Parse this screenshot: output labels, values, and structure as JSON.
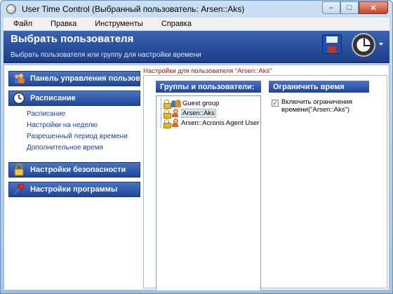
{
  "window": {
    "title": "User Time Control (Выбранный пользователь: Arsen::Aks)",
    "controls": {
      "minimize": "–",
      "maximize": "□",
      "close": "✕"
    }
  },
  "menu": {
    "items": [
      {
        "label": "Файл"
      },
      {
        "label": "Правка"
      },
      {
        "label": "Инструменты"
      },
      {
        "label": "Справка"
      }
    ]
  },
  "banner": {
    "title": "Выбрать пользователя",
    "subtitle": "Выбрать пользователя или группу для настройки времени",
    "icons": [
      "save-icon",
      "clock-icon"
    ]
  },
  "sidebar": {
    "groups": [
      {
        "label": "Панель управления пользователями",
        "icon": "users-icon",
        "links": []
      },
      {
        "label": "Расписание",
        "icon": "clock-icon",
        "links": [
          "Расписание",
          "Настройки на неделю",
          "Разрешенный период времени",
          "Дополнительное время"
        ]
      },
      {
        "label": "Настройки безопасности",
        "icon": "lock-icon",
        "links": []
      },
      {
        "label": "Настройки программы",
        "icon": "pin-icon",
        "links": []
      }
    ]
  },
  "main": {
    "settings_for_label": "Настройки для пользователя \"Arsen::Aks\"",
    "users_panel": {
      "title": "Группы и пользователи:",
      "entries": [
        {
          "name": "Guest group",
          "type": "group",
          "selected": false
        },
        {
          "name": "Arsen::Aks",
          "type": "user",
          "selected": true
        },
        {
          "name": "Arsen::Acronis Agent User",
          "type": "user",
          "selected": false
        }
      ]
    },
    "limit_panel": {
      "title": "Ограничить время",
      "checkbox_checked": true,
      "checkbox_mark": "✓",
      "checkbox_label": "Включить ограничения времени(\"Arsen::Aks\")"
    }
  }
}
